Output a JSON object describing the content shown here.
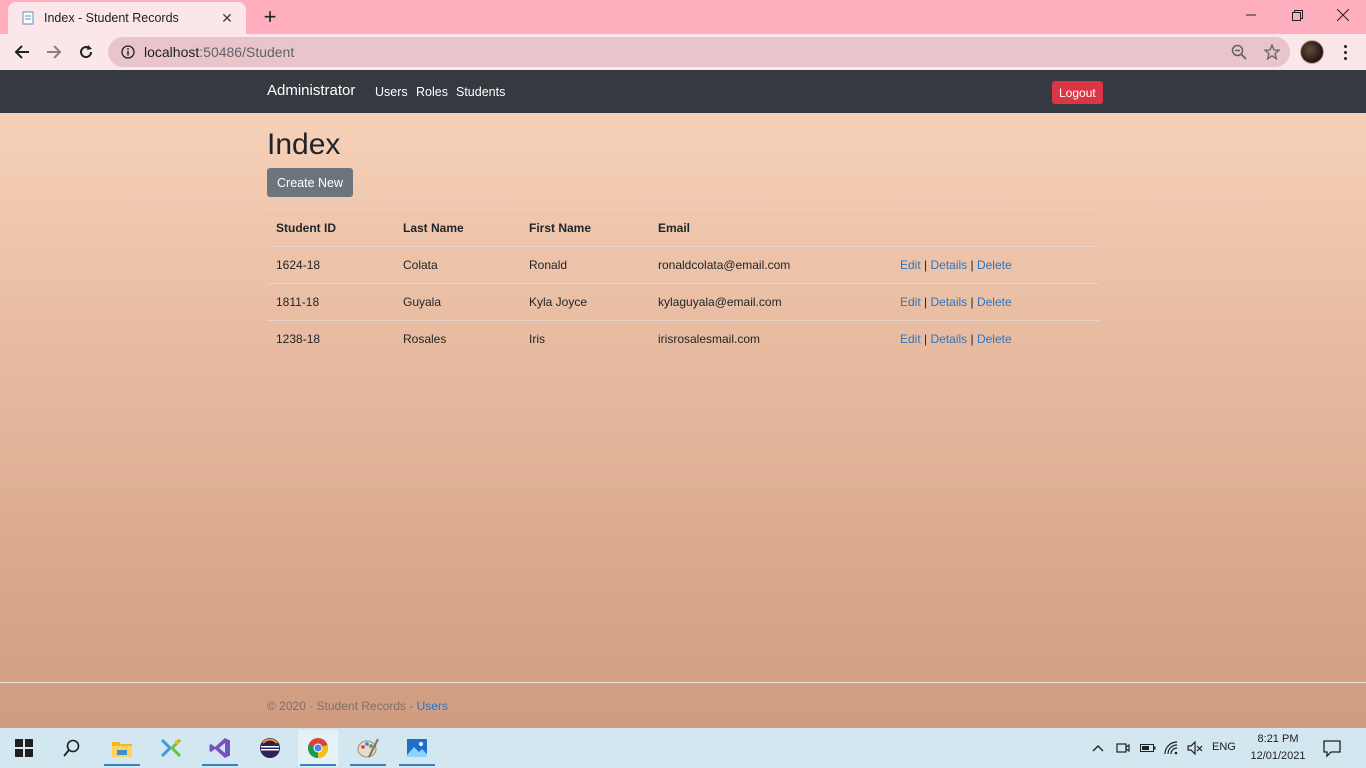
{
  "browser": {
    "tab_title": "Index - Student Records",
    "url_host": "localhost",
    "url_rest": ":50486/Student"
  },
  "nav": {
    "brand": "Administrator",
    "links": [
      "Users",
      "Roles",
      "Students"
    ],
    "logout": "Logout"
  },
  "page": {
    "title": "Index",
    "create_new": "Create New"
  },
  "table": {
    "headers": [
      "Student ID",
      "Last Name",
      "First Name",
      "Email"
    ],
    "rows": [
      {
        "id": "1624-18",
        "last": "Colata",
        "first": "Ronald",
        "email": "ronaldcolata@email.com"
      },
      {
        "id": "1811-18",
        "last": "Guyala",
        "first": "Kyla Joyce",
        "email": "kylaguyala@email.com"
      },
      {
        "id": "1238-18",
        "last": "Rosales",
        "first": "Iris",
        "email": "irisrosalesmail.com"
      }
    ],
    "actions": {
      "edit": "Edit",
      "details": "Details",
      "delete": "Delete",
      "separator": "|"
    }
  },
  "footer": {
    "text": "© 2020 - Student Records - ",
    "link": "Users"
  },
  "taskbar": {
    "apps": [
      "windows-start-icon",
      "search-icon",
      "file-explorer-icon",
      "xamarin-icon",
      "visual-studio-icon",
      "eclipse-icon",
      "chrome-icon",
      "paint-icon",
      "photos-icon"
    ],
    "lang": "ENG",
    "time": "8:21 PM",
    "date": "12/01/2021"
  },
  "colors": {
    "tabstrip": "#ffaebe",
    "navbar": "#343a40",
    "logout": "#dc3545",
    "create_button": "#6c757d",
    "link": "#2f74c0"
  }
}
